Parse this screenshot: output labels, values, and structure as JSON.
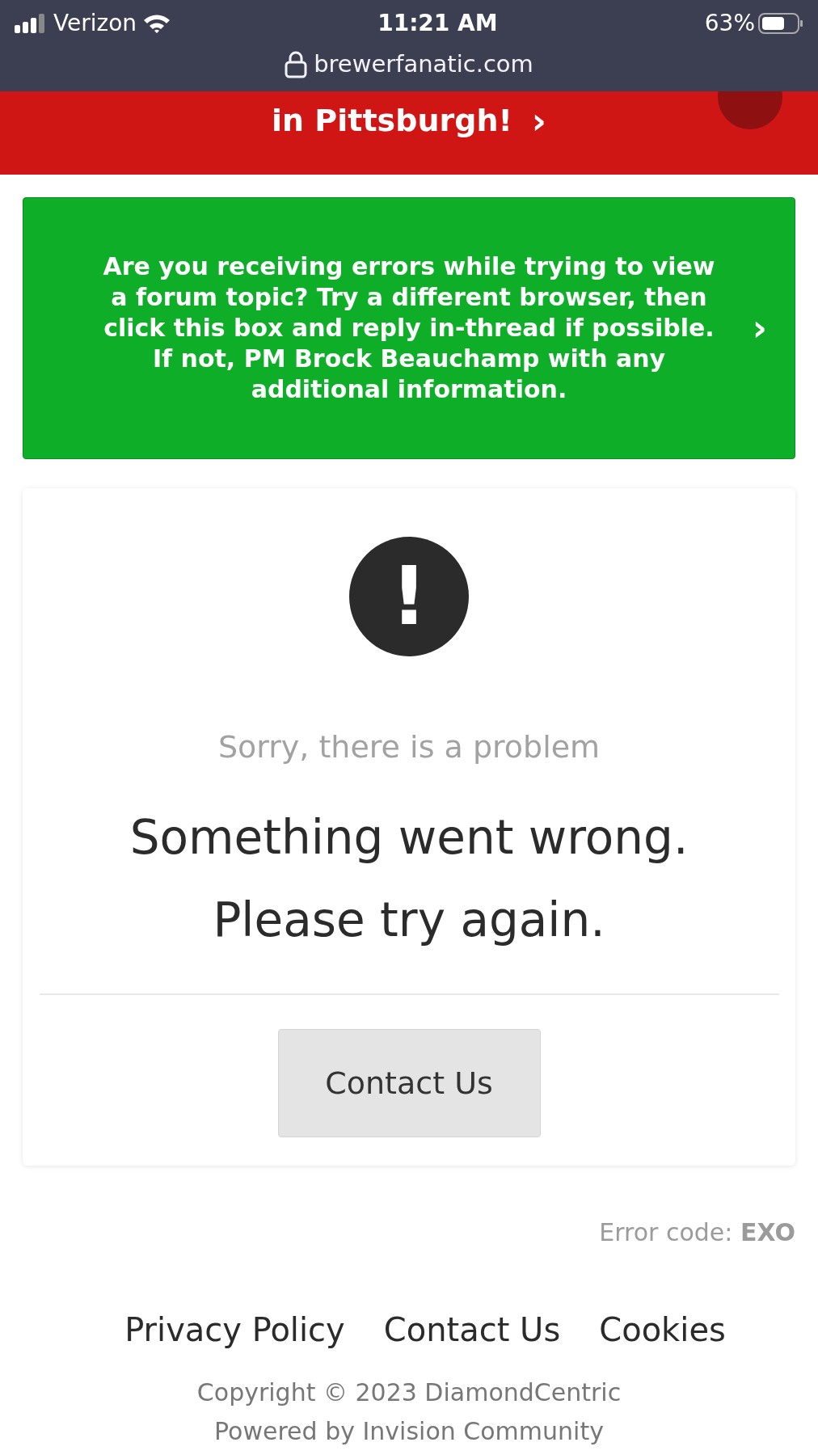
{
  "status_bar": {
    "carrier": "Verizon",
    "time": "11:21 AM",
    "battery": "63%"
  },
  "address_bar": {
    "url": "brewerfanatic.com"
  },
  "promo_banner": {
    "text": "in Pittsburgh!",
    "arrow": "›"
  },
  "notice": {
    "text": "Are you receiving errors while trying to view a forum topic? Try a different browser, then click this box and reply in-thread if possible. If not, PM Brock Beauchamp with any additional information.",
    "arrow": "›"
  },
  "error_card": {
    "icon": "!",
    "subtitle": "Sorry, there is a problem",
    "message": "Something went wrong. Please try again.",
    "button": "Contact Us"
  },
  "error_code": "Error code: **EXO**",
  "footer": {
    "links": [
      "Privacy Policy",
      "Contact Us",
      "Cookies"
    ],
    "copyright": "Copyright © 2023 DiamondCentric",
    "powered_by": "Powered by Invision Community"
  }
}
